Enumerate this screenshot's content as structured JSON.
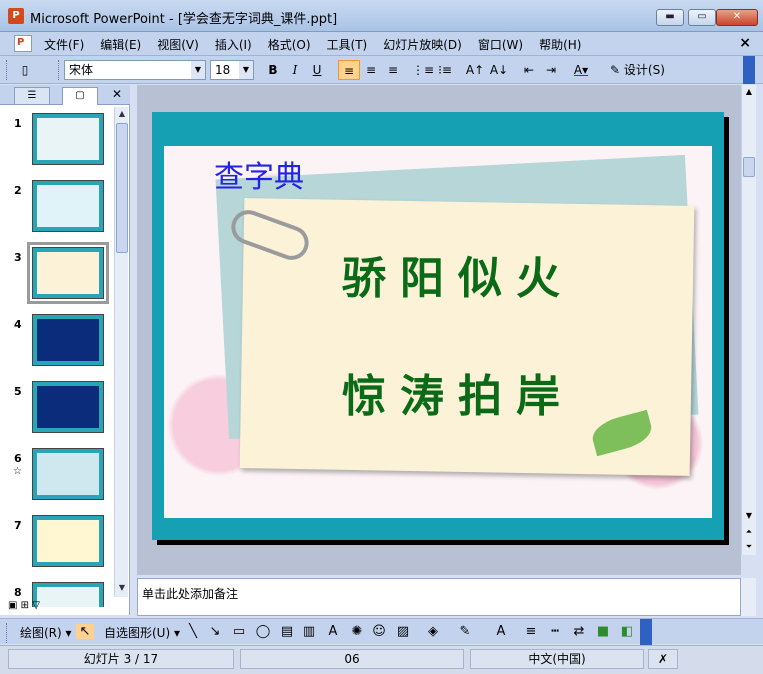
{
  "window": {
    "title": "Microsoft PowerPoint - [学会查无字词典_课件.ppt]",
    "buttons": {
      "minimize": "▬",
      "maximize": "▭",
      "close": "✕"
    }
  },
  "menubar": {
    "items": [
      "文件(F)",
      "编辑(E)",
      "视图(V)",
      "插入(I)",
      "格式(O)",
      "工具(T)",
      "幻灯片放映(D)",
      "窗口(W)",
      "帮助(H)"
    ],
    "close": "×"
  },
  "format_toolbar": {
    "font": "宋体",
    "size": "18",
    "bold": "B",
    "italic": "I",
    "underline": "U",
    "design": "设计(S)"
  },
  "thumbnails": [
    {
      "num": "1",
      "star": ""
    },
    {
      "num": "2",
      "star": ""
    },
    {
      "num": "3",
      "star": ""
    },
    {
      "num": "4",
      "star": ""
    },
    {
      "num": "5",
      "star": ""
    },
    {
      "num": "6",
      "star": "☆"
    },
    {
      "num": "7",
      "star": ""
    },
    {
      "num": "8",
      "star": ""
    }
  ],
  "slide": {
    "title": "查字典",
    "line1": "骄阳似火",
    "line2": "惊涛拍岸"
  },
  "notes": {
    "placeholder": "单击此处添加备注"
  },
  "draw_toolbar": {
    "draw": "绘图(R)",
    "autoshapes": "自选图形(U)"
  },
  "statusbar": {
    "slide": "幻灯片 3 / 17",
    "design": "06",
    "language": "中文(中国)"
  },
  "colors": {
    "accent": "#16a0b3",
    "title_blue": "#2323e3",
    "slide_green": "#0a6a16"
  }
}
